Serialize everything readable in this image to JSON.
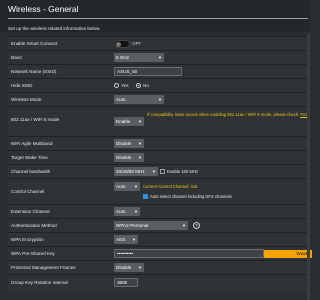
{
  "page": {
    "title": "Wireless - General",
    "subtitle": "Set up the wireless related information below"
  },
  "smart_connect": {
    "label": "Enable Smart Connect",
    "state": "OFF"
  },
  "band": {
    "label": "Band",
    "value": "5 GHz"
  },
  "ssid": {
    "label": "Network Name (SSID)",
    "value": "ASUS_50"
  },
  "hide_ssid": {
    "label": "Hide SSID",
    "options": [
      "Yes",
      "No"
    ],
    "selected": "No"
  },
  "wireless_mode": {
    "label": "Wireless Mode",
    "value": "Auto"
  },
  "wifi6": {
    "label": "802.11ax / WiFi 6 mode",
    "value": "Enable",
    "note": "If compatibility issue occurs when enabling 802.11ax / WiFi 6 mode, please check:",
    "note_link": "FAQ"
  },
  "agile_multiband": {
    "label": "WiFi Agile Multiband",
    "value": "Disable"
  },
  "target_wake_time": {
    "label": "Target Wake Time",
    "value": "Disable"
  },
  "channel_bandwidth": {
    "label": "Channel bandwidth",
    "value": "20/40/80 MHz",
    "checkbox_label": "Enable 160 MHz"
  },
  "control_channel": {
    "label": "Control Channel",
    "value": "Auto",
    "current": "Current Control Channel: 116",
    "checkbox_label": "Auto select channel including DFS channels"
  },
  "extension_channel": {
    "label": "Extension Channel",
    "value": "Auto"
  },
  "auth_method": {
    "label": "Authentication Method",
    "value": "WPA2-Personal",
    "help": "?"
  },
  "wpa_encryption": {
    "label": "WPA Encryption",
    "value": "AES"
  },
  "wpa_key": {
    "label": "WPA Pre-Shared Key",
    "value": "••••••••••",
    "strength": "Weak"
  },
  "pmf": {
    "label": "Protected Management Frames",
    "value": "Disable"
  },
  "group_key": {
    "label": "Group Key Rotation Interval",
    "value": "3600"
  },
  "colors": {
    "accent_warning": "#f0c419",
    "strength_weak": "#f4a300",
    "background": "#2b2e31"
  }
}
